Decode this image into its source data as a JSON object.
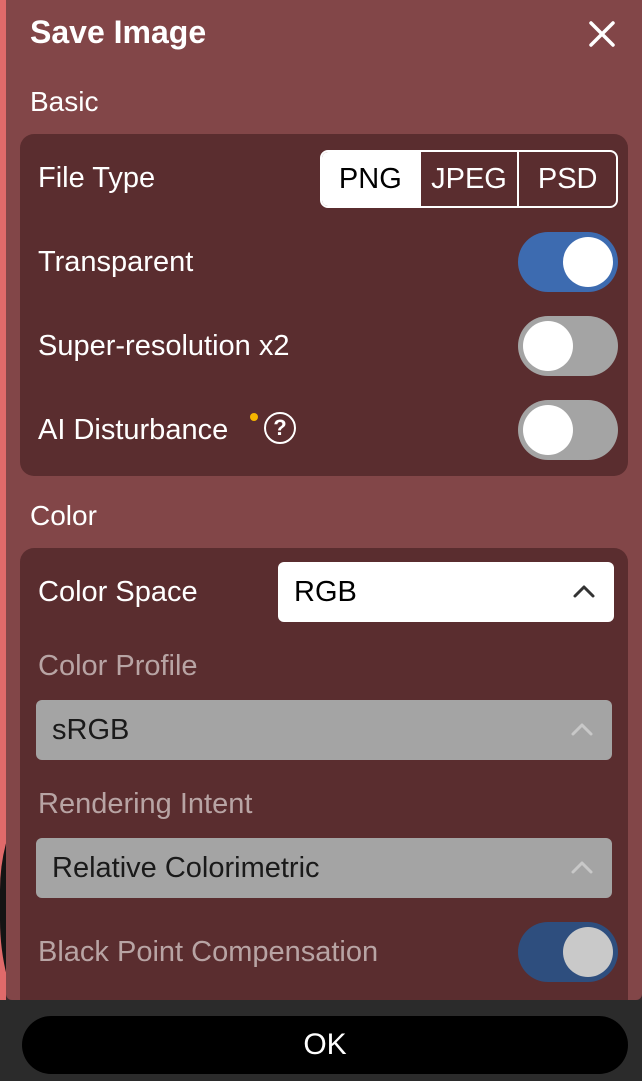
{
  "dialog": {
    "title": "Save Image"
  },
  "basic": {
    "section_label": "Basic",
    "file_type": {
      "label": "File Type",
      "options": [
        "PNG",
        "JPEG",
        "PSD"
      ],
      "selected": "PNG"
    },
    "transparent": {
      "label": "Transparent",
      "on": true
    },
    "super_resolution": {
      "label": "Super-resolution x2",
      "on": false
    },
    "ai_disturbance": {
      "label": "AI Disturbance",
      "help": "?",
      "on": false
    }
  },
  "color": {
    "section_label": "Color",
    "color_space": {
      "label": "Color Space",
      "value": "RGB"
    },
    "color_profile": {
      "label": "Color Profile",
      "value": "sRGB"
    },
    "rendering_intent": {
      "label": "Rendering Intent",
      "value": "Relative Colorimetric"
    },
    "black_point": {
      "label": "Black Point Compensation",
      "on": true
    }
  },
  "footer": {
    "ok_label": "OK"
  },
  "colors": {
    "dialog_bg": "#824648",
    "card_bg": "#5a2d2f",
    "toggle_on": "#3d6bb0",
    "toggle_off": "#a4a4a4"
  }
}
